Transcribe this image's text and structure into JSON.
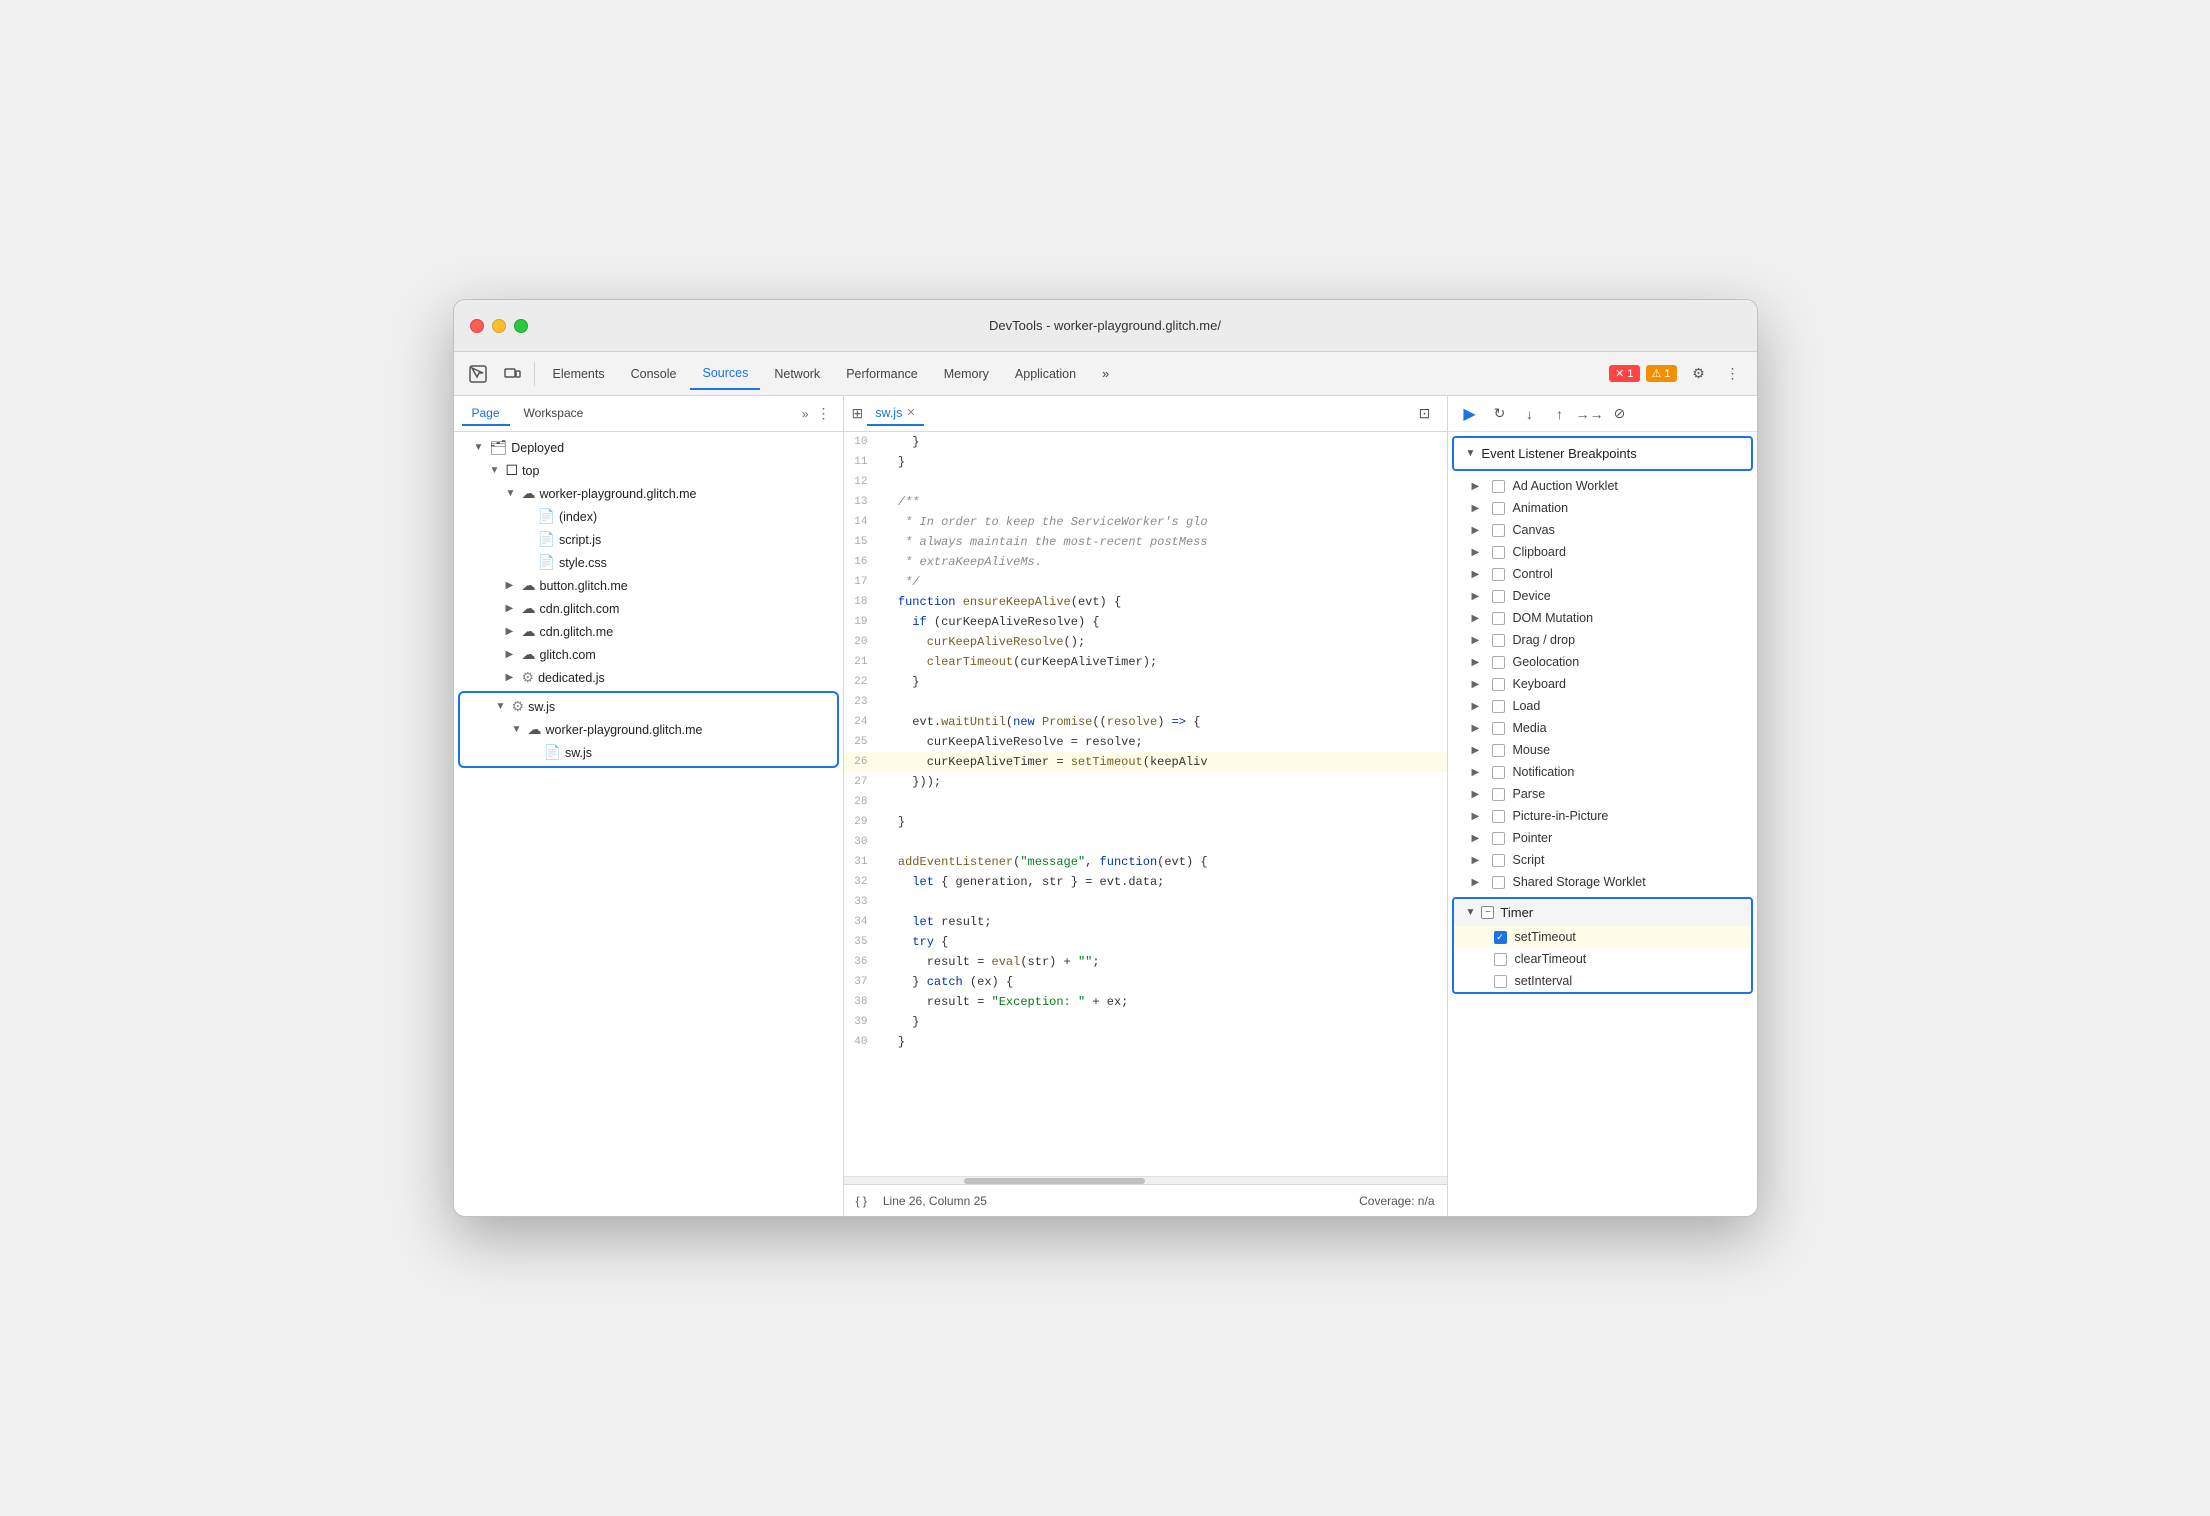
{
  "window": {
    "title": "DevTools - worker-playground.glitch.me/"
  },
  "toolbar": {
    "tabs": [
      "Elements",
      "Console",
      "Sources",
      "Network",
      "Performance",
      "Memory",
      "Application"
    ],
    "active_tab": "Sources",
    "more_btn": "»",
    "error_count": "1",
    "warn_count": "1"
  },
  "left_panel": {
    "tabs": [
      "Page",
      "Workspace"
    ],
    "active_tab": "Page",
    "more": "»",
    "tree": [
      {
        "indent": 1,
        "type": "folder",
        "label": "Deployed",
        "expanded": true
      },
      {
        "indent": 2,
        "type": "folder",
        "label": "top",
        "expanded": true
      },
      {
        "indent": 3,
        "type": "cloud",
        "label": "worker-playground.glitch.me",
        "expanded": true
      },
      {
        "indent": 4,
        "type": "file-html",
        "label": "(index)"
      },
      {
        "indent": 4,
        "type": "file-js",
        "label": "script.js"
      },
      {
        "indent": 4,
        "type": "file-css",
        "label": "style.css"
      },
      {
        "indent": 3,
        "type": "cloud",
        "label": "button.glitch.me",
        "expanded": false
      },
      {
        "indent": 3,
        "type": "cloud",
        "label": "cdn.glitch.com",
        "expanded": false
      },
      {
        "indent": 3,
        "type": "cloud",
        "label": "cdn.glitch.me",
        "expanded": false
      },
      {
        "indent": 3,
        "type": "cloud",
        "label": "glitch.com",
        "expanded": false
      },
      {
        "indent": 3,
        "type": "file-gear",
        "label": "dedicated.js",
        "expanded": false
      },
      {
        "indent": 3,
        "type": "gear",
        "label": "sw.js",
        "expanded": true,
        "selected": true
      },
      {
        "indent": 4,
        "type": "cloud",
        "label": "worker-playground.glitch.me",
        "expanded": true,
        "selected": true
      },
      {
        "indent": 5,
        "type": "file-js",
        "label": "sw.js",
        "selected": true
      }
    ]
  },
  "code_panel": {
    "active_file": "sw.js",
    "lines": [
      {
        "num": 10,
        "content": "    }"
      },
      {
        "num": 11,
        "content": "  }"
      },
      {
        "num": 12,
        "content": ""
      },
      {
        "num": 13,
        "content": "  /**"
      },
      {
        "num": 14,
        "content": "   * In order to keep the ServiceWorker's glo"
      },
      {
        "num": 15,
        "content": "   * always maintain the most-recent postMess"
      },
      {
        "num": 16,
        "content": "   * extraKeepAliveMs."
      },
      {
        "num": 17,
        "content": "   */"
      },
      {
        "num": 18,
        "content": "  function ensureKeepAlive(evt) {"
      },
      {
        "num": 19,
        "content": "    if (curKeepAliveResolve) {"
      },
      {
        "num": 20,
        "content": "      curKeepAliveResolve();"
      },
      {
        "num": 21,
        "content": "      clearTimeout(curKeepAliveTimer);"
      },
      {
        "num": 22,
        "content": "    }"
      },
      {
        "num": 23,
        "content": ""
      },
      {
        "num": 24,
        "content": "    evt.waitUntil(new Promise((resolve) => {"
      },
      {
        "num": 25,
        "content": "      curKeepAliveResolve = resolve;"
      },
      {
        "num": 26,
        "content": "      curKeepAliveTimer = setTimeout(keepAliv",
        "highlighted": true
      },
      {
        "num": 27,
        "content": "    }));"
      },
      {
        "num": 28,
        "content": ""
      },
      {
        "num": 29,
        "content": "  }"
      },
      {
        "num": 30,
        "content": ""
      },
      {
        "num": 31,
        "content": "  addEventListener(\"message\", function(evt) {"
      },
      {
        "num": 32,
        "content": "    let { generation, str } = evt.data;"
      },
      {
        "num": 33,
        "content": ""
      },
      {
        "num": 34,
        "content": "    let result;"
      },
      {
        "num": 35,
        "content": "    try {"
      },
      {
        "num": 36,
        "content": "      result = eval(str) + \"\";"
      },
      {
        "num": 37,
        "content": "    } catch (ex) {"
      },
      {
        "num": 38,
        "content": "      result = \"Exception: \" + ex;"
      },
      {
        "num": 39,
        "content": "    }"
      },
      {
        "num": 40,
        "content": "  }"
      }
    ],
    "status": {
      "format_btn": "{ }",
      "position": "Line 26, Column 25",
      "coverage": "Coverage: n/a"
    }
  },
  "right_panel": {
    "header": "Event Listener Breakpoints",
    "items": [
      {
        "label": "Ad Auction Worklet",
        "expanded": false,
        "checked": false
      },
      {
        "label": "Animation",
        "expanded": false,
        "checked": false
      },
      {
        "label": "Canvas",
        "expanded": false,
        "checked": false
      },
      {
        "label": "Clipboard",
        "expanded": false,
        "checked": false
      },
      {
        "label": "Control",
        "expanded": false,
        "checked": false
      },
      {
        "label": "Device",
        "expanded": false,
        "checked": false
      },
      {
        "label": "DOM Mutation",
        "expanded": false,
        "checked": false
      },
      {
        "label": "Drag / drop",
        "expanded": false,
        "checked": false
      },
      {
        "label": "Geolocation",
        "expanded": false,
        "checked": false
      },
      {
        "label": "Keyboard",
        "expanded": false,
        "checked": false
      },
      {
        "label": "Load",
        "expanded": false,
        "checked": false
      },
      {
        "label": "Media",
        "expanded": false,
        "checked": false
      },
      {
        "label": "Mouse",
        "expanded": false,
        "checked": false
      },
      {
        "label": "Notification",
        "expanded": false,
        "checked": false
      },
      {
        "label": "Parse",
        "expanded": false,
        "checked": false
      },
      {
        "label": "Picture-in-Picture",
        "expanded": false,
        "checked": false
      },
      {
        "label": "Pointer",
        "expanded": false,
        "checked": false
      },
      {
        "label": "Script",
        "expanded": false,
        "checked": false
      },
      {
        "label": "Shared Storage Worklet",
        "expanded": false,
        "checked": false
      }
    ],
    "timer_section": {
      "label": "Timer",
      "expanded": true,
      "sub_items": [
        {
          "label": "setTimeout",
          "checked": true,
          "highlighted": true
        },
        {
          "label": "clearTimeout",
          "checked": false
        },
        {
          "label": "setInterval",
          "checked": false
        }
      ]
    }
  },
  "debug_controls": {
    "play": "▶",
    "step_over": "↻",
    "step_into": "↓",
    "step_out": "↑",
    "step": "→",
    "deactivate": "⊘"
  }
}
